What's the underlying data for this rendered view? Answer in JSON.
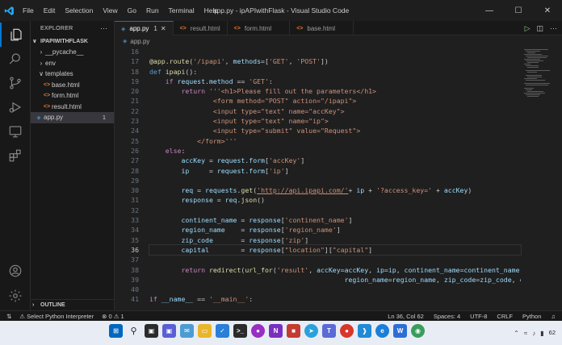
{
  "window": {
    "title": "app.py - ipAPIwithFlask - Visual Studio Code",
    "menu": [
      "File",
      "Edit",
      "Selection",
      "View",
      "Go",
      "Run",
      "Terminal",
      "Help"
    ]
  },
  "sidebar": {
    "header": "EXPLORER",
    "project": "IPAPIWITHFLASK",
    "items": [
      {
        "label": "__pycache__",
        "kind": "folder",
        "expanded": false
      },
      {
        "label": "env",
        "kind": "folder",
        "expanded": false
      },
      {
        "label": "templates",
        "kind": "folder",
        "expanded": true
      },
      {
        "label": "base.html",
        "kind": "html"
      },
      {
        "label": "form.html",
        "kind": "html"
      },
      {
        "label": "result.html",
        "kind": "html"
      },
      {
        "label": "app.py",
        "kind": "py",
        "badge": "1"
      }
    ],
    "outline": "OUTLINE"
  },
  "tabs": [
    {
      "label": "app.py",
      "badge": "1",
      "active": true
    },
    {
      "label": "result.html"
    },
    {
      "label": "form.html"
    },
    {
      "label": "base.html"
    }
  ],
  "breadcrumb": "app.py",
  "editor": {
    "line_numbers": [
      "16",
      "17",
      "18",
      "19",
      "20",
      "21",
      "22",
      "23",
      "24",
      "25",
      "26",
      "27",
      "28",
      "29",
      "30",
      "31",
      "32",
      "33",
      "34",
      "35",
      "36",
      "37",
      "38",
      "39",
      "40",
      "41"
    ],
    "current_line": "36"
  },
  "status": {
    "interpreter": "Select Python Interpreter",
    "errors": "0",
    "warnings": "1",
    "position": "Ln 36, Col 62",
    "spaces": "Spaces: 4",
    "encoding": "UTF-8",
    "eol": "CRLF",
    "language": "Python"
  },
  "taskbar": {
    "tray_badge": "62"
  }
}
